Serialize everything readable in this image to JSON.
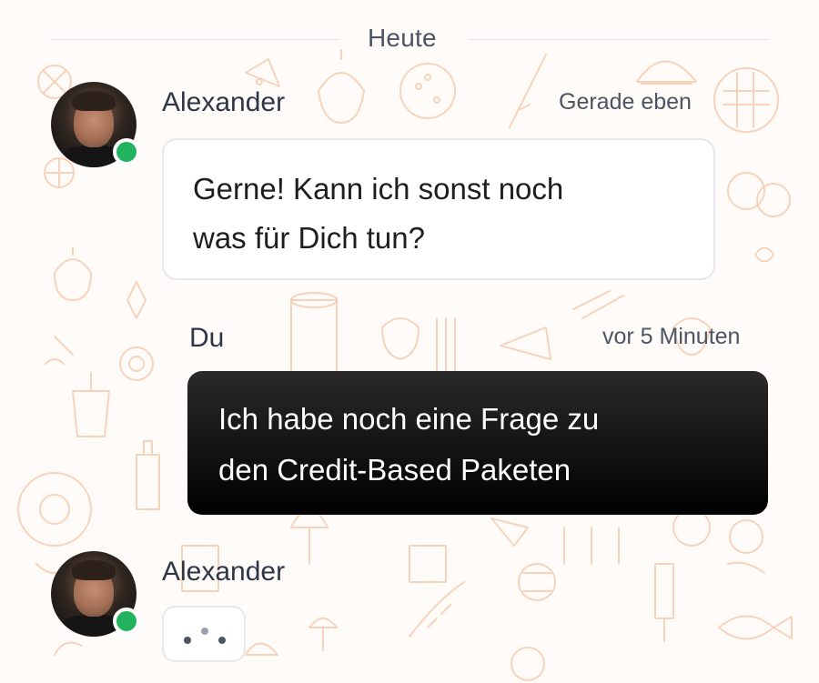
{
  "date_divider": {
    "label": "Heute"
  },
  "messages": [
    {
      "sender": "Alexander",
      "time": "Gerade eben",
      "text_line1": "Gerne! Kann ich sonst noch",
      "text_line2": "was für Dich tun?",
      "online": true
    },
    {
      "sender": "Du",
      "time": "vor 5 Minuten",
      "text_line1": "Ich habe noch eine Frage zu",
      "text_line2": "den Credit-Based Paketen"
    },
    {
      "sender": "Alexander",
      "typing": true,
      "online": true
    }
  ],
  "colors": {
    "online": "#22b35e",
    "outgoing_bubble": "#000000",
    "incoming_bubble": "#ffffff",
    "doodle": "#f6c9ad"
  }
}
